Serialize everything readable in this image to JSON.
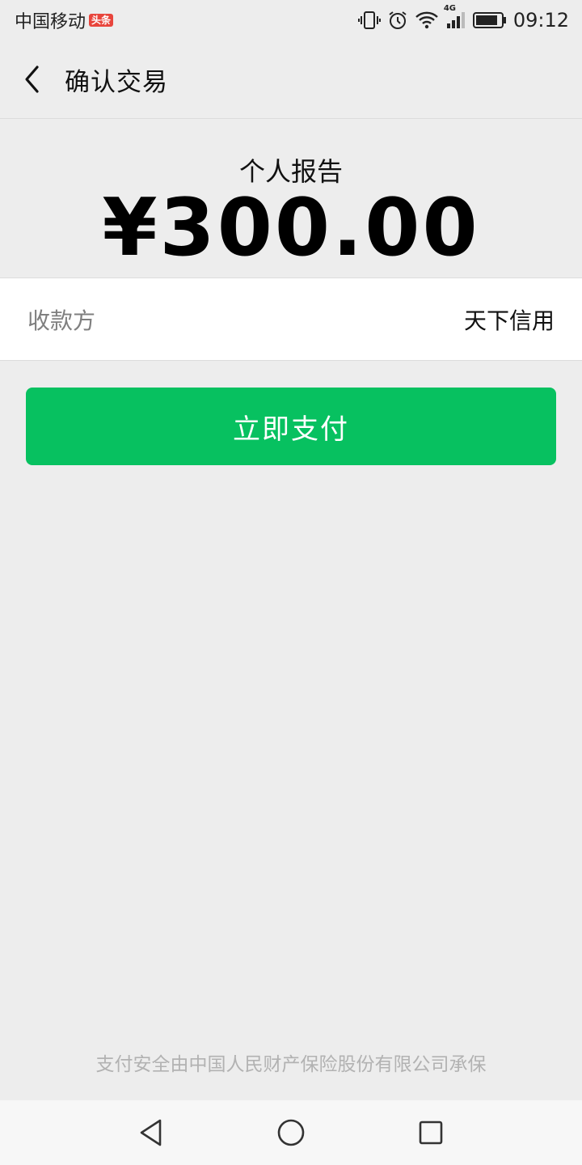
{
  "status_bar": {
    "carrier": "中国移动",
    "app_badge": "头条",
    "network": "4G",
    "time": "09:12"
  },
  "header": {
    "title": "确认交易",
    "back_icon": "chevron-left-icon"
  },
  "order": {
    "product_name": "个人报告",
    "amount": "¥300.00"
  },
  "payee": {
    "label": "收款方",
    "value": "天下信用"
  },
  "actions": {
    "pay_label": "立即支付"
  },
  "footer": {
    "note": "支付安全由中国人民财产保险股份有限公司承保"
  },
  "nav": {
    "back_icon": "triangle-back-icon",
    "home_icon": "circle-home-icon",
    "recents_icon": "square-recents-icon"
  },
  "colors": {
    "accent": "#07c160",
    "background": "#ededed"
  }
}
